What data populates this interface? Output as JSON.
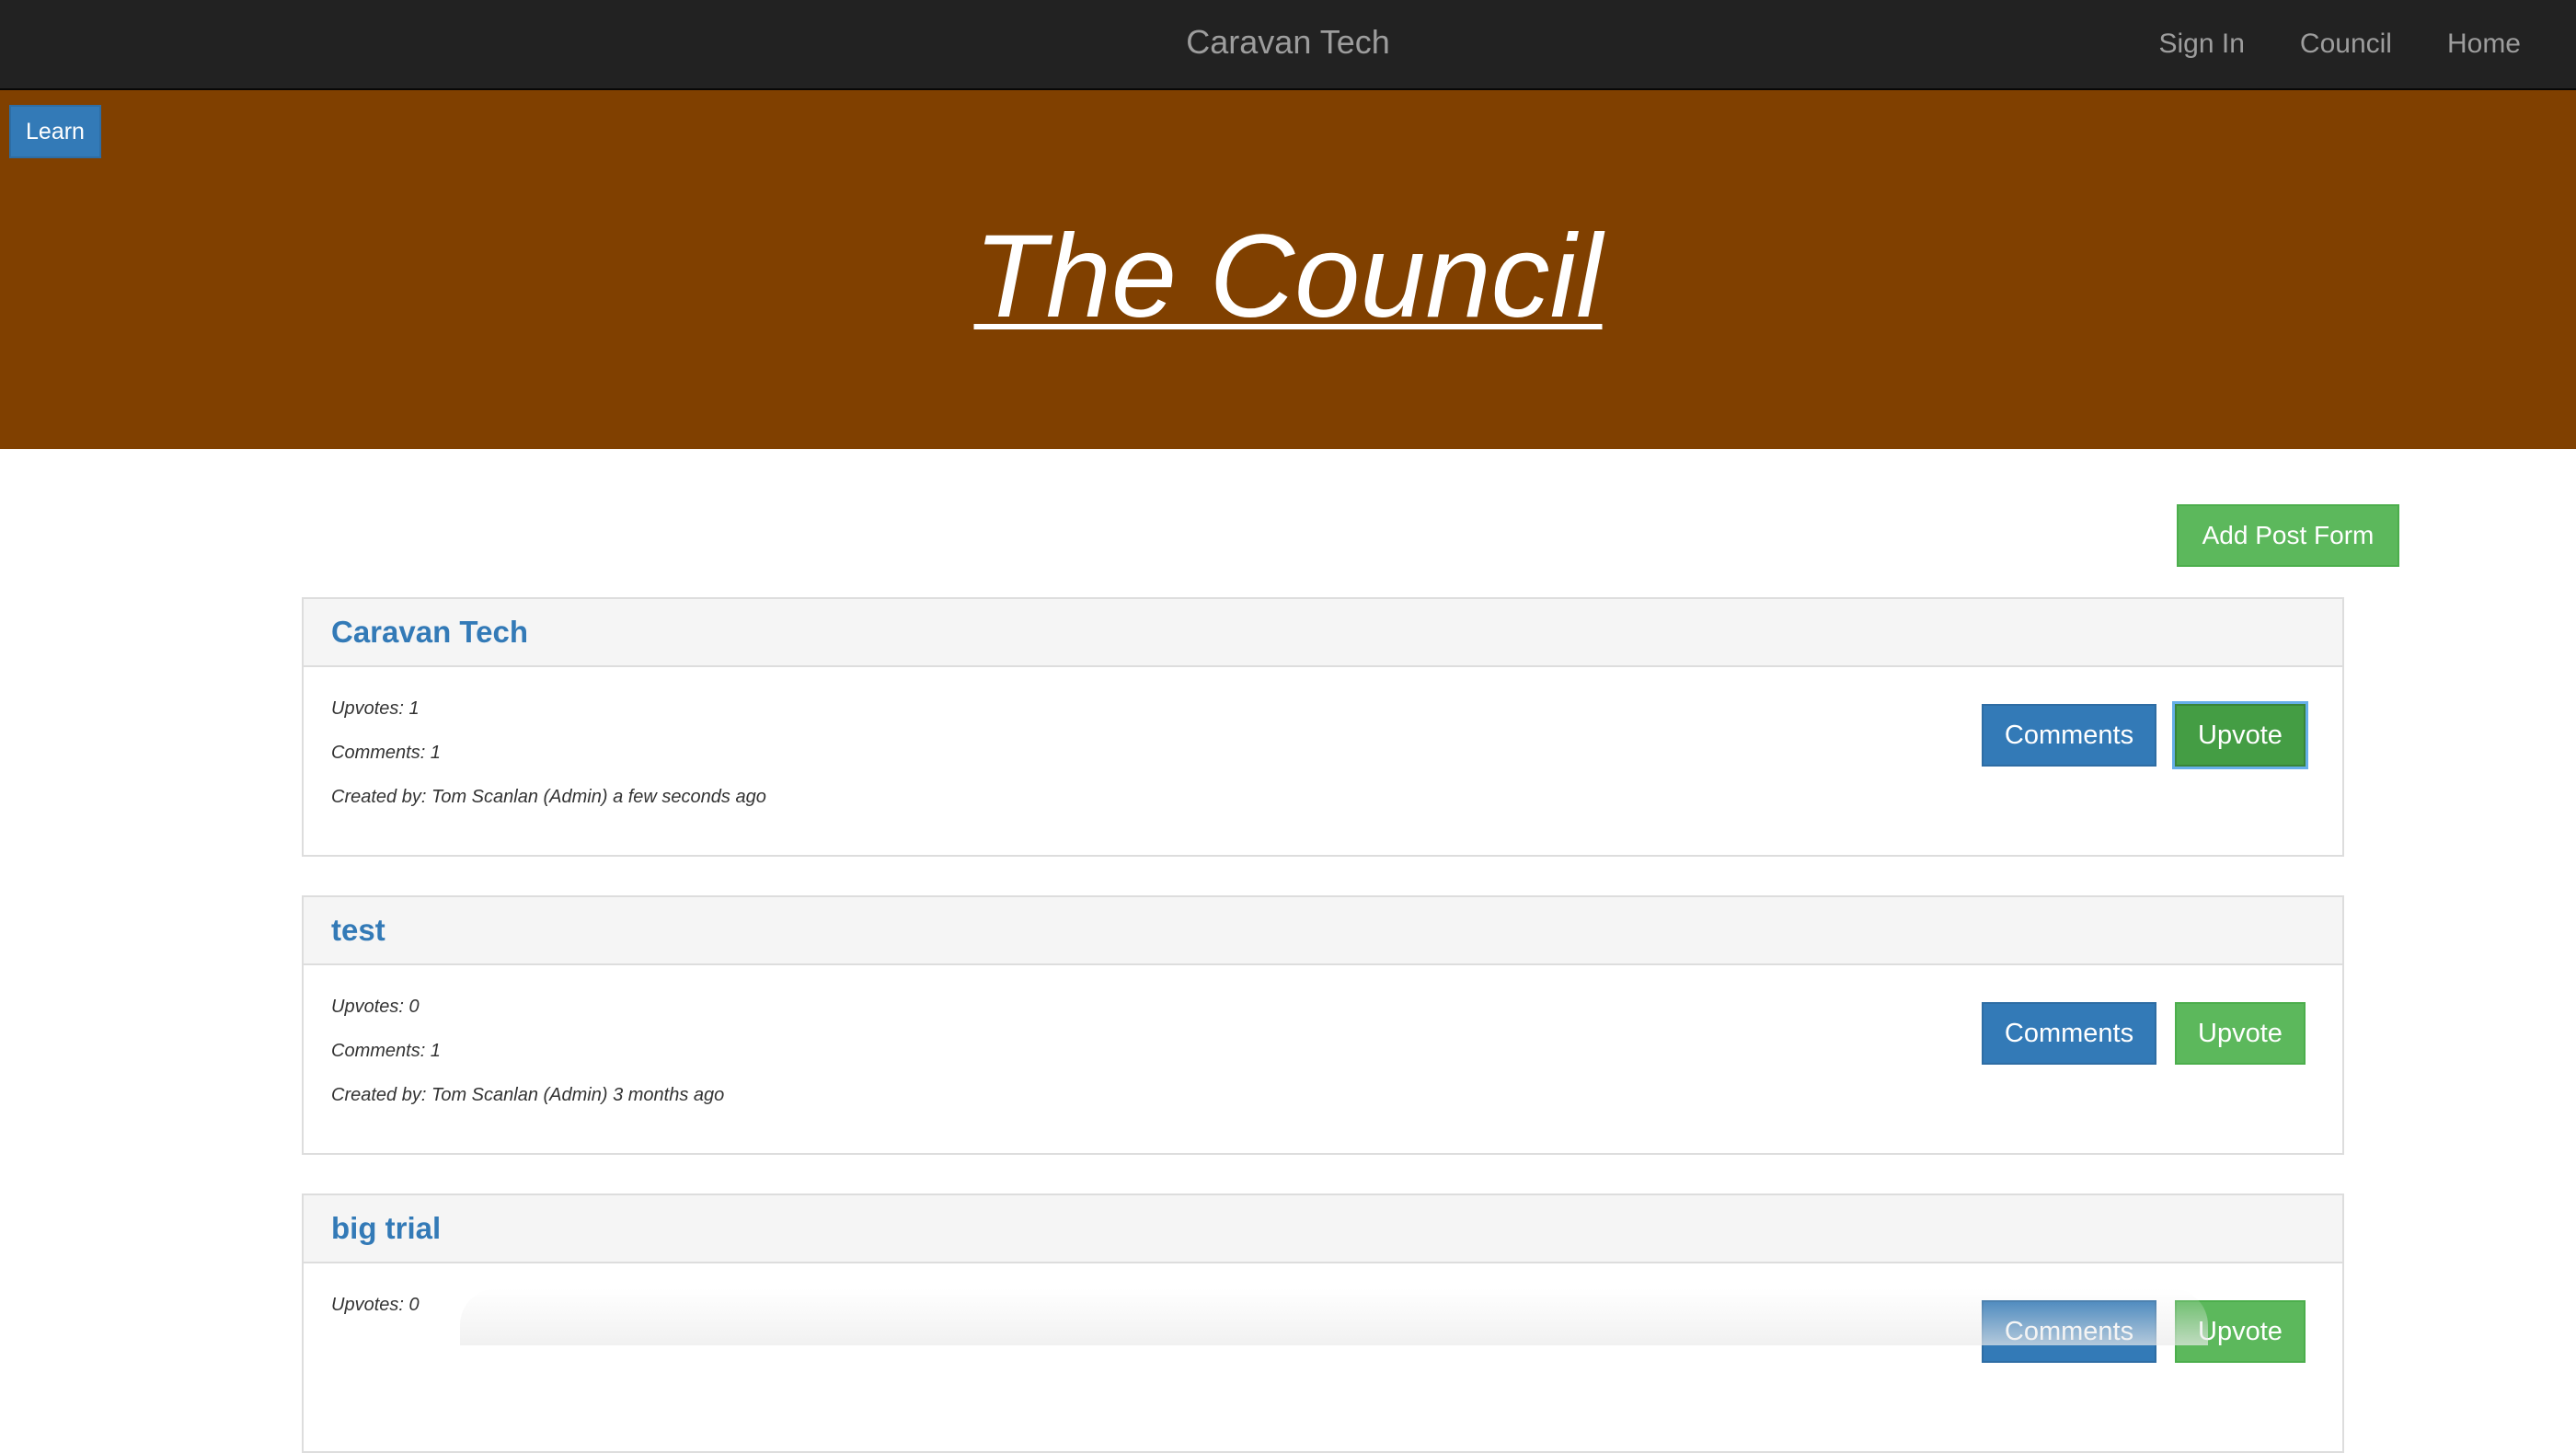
{
  "navbar": {
    "brand": "Caravan Tech",
    "links": [
      "Sign In",
      "Council",
      "Home"
    ]
  },
  "hero": {
    "learn_label": "Learn",
    "title": "The Council"
  },
  "add_post_label": "Add Post Form",
  "posts": [
    {
      "title": "Caravan Tech",
      "upvotes": "Upvotes: 1",
      "comments": "Comments: 1",
      "created": "Created by: Tom Scanlan (Admin) a few seconds ago",
      "comments_label": "Comments",
      "upvote_label": "Upvote"
    },
    {
      "title": "test",
      "upvotes": "Upvotes: 0",
      "comments": "Comments: 1",
      "created": "Created by: Tom Scanlan (Admin) 3 months ago",
      "comments_label": "Comments",
      "upvote_label": "Upvote"
    },
    {
      "title": "big trial",
      "upvotes": "Upvotes: 0",
      "comments": "",
      "created": "",
      "comments_label": "Comments",
      "upvote_label": "Upvote"
    }
  ],
  "colors": {
    "navbar": "#222222",
    "hero": "#804000",
    "primary": "#337ab7",
    "success": "#5cb85c"
  }
}
